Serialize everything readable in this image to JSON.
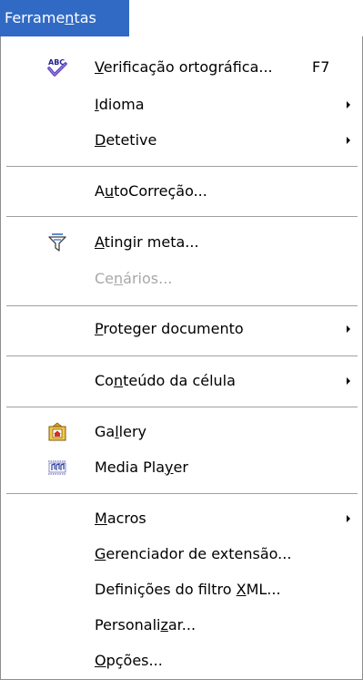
{
  "menu": {
    "title": "Ferramentas",
    "title_mnemonic": [
      "Ferrame",
      "n",
      "tas"
    ],
    "items": [
      {
        "id": "spelling",
        "pre": "",
        "mn": "V",
        "post": "erificação ortográfica...",
        "shortcut": "F7",
        "icon": "spellcheck-abc-icon"
      },
      {
        "id": "language",
        "pre": "",
        "mn": "I",
        "post": "dioma",
        "submenu": true
      },
      {
        "id": "detective",
        "pre": "",
        "mn": "D",
        "post": "etetive",
        "submenu": true
      },
      {
        "id": "autocorrect",
        "pre": "A",
        "mn": "u",
        "post": "toCorreção..."
      },
      {
        "id": "goal-seek",
        "pre": "",
        "mn": "A",
        "post": "tingir meta...",
        "icon": "goal-seek-funnel-icon"
      },
      {
        "id": "scenarios",
        "pre": "Ce",
        "mn": "n",
        "post": "ários...",
        "disabled": true
      },
      {
        "id": "protect-document",
        "pre": "",
        "mn": "P",
        "post": "roteger documento",
        "submenu": true
      },
      {
        "id": "cell-contents",
        "pre": "Co",
        "mn": "n",
        "post": "teúdo da célula",
        "submenu": true
      },
      {
        "id": "gallery",
        "pre": "Ga",
        "mn": "l",
        "post": "lery",
        "icon": "gallery-icon"
      },
      {
        "id": "media-player",
        "pre": "Media Pla",
        "mn": "y",
        "post": "er",
        "icon": "media-player-icon"
      },
      {
        "id": "macros",
        "pre": "",
        "mn": "M",
        "post": "acros",
        "submenu": true
      },
      {
        "id": "extension-manager",
        "pre": "",
        "mn": "G",
        "post": "erenciador de extensão..."
      },
      {
        "id": "xml-filter-settings",
        "pre": "Definições do filtro ",
        "mn": "X",
        "post": "ML..."
      },
      {
        "id": "customize",
        "pre": "Personali",
        "mn": "z",
        "post": "ar..."
      },
      {
        "id": "options",
        "pre": "",
        "mn": "O",
        "post": "pções..."
      }
    ]
  }
}
